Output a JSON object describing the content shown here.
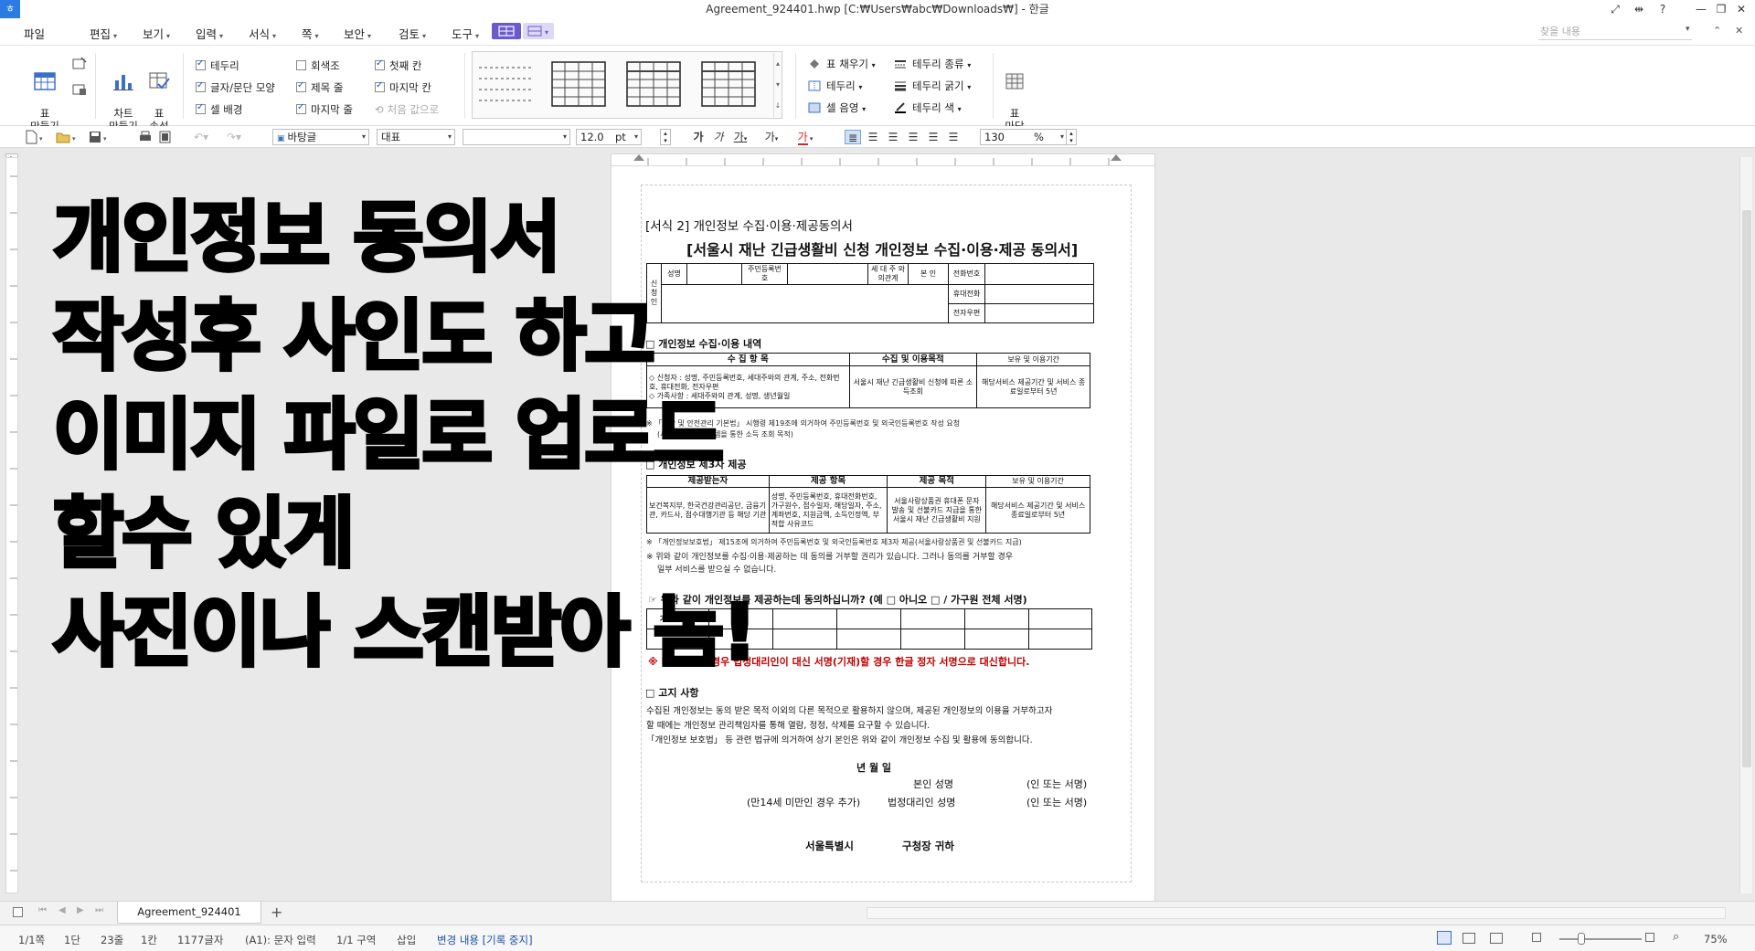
{
  "window": {
    "title": "Agreement_924401.hwp [C:₩Users₩abc₩Downloads₩] - 한글",
    "app_icon": "ㅎ",
    "controls": [
      "⤢",
      "⇹",
      "?",
      "—",
      "❐",
      "✕"
    ]
  },
  "menu": {
    "items": [
      "파일",
      "편집",
      "보기",
      "입력",
      "서식",
      "쪽",
      "보안",
      "검토",
      "도구"
    ],
    "search_placeholder": "찾을 내용",
    "right_controls": [
      "▾",
      "⌃",
      "✕"
    ]
  },
  "ribbon": {
    "table_make": "표\n만들기",
    "chart_make": "차트\n만들기",
    "table_props": "표\n속성",
    "checks_col1": [
      {
        "label": "테두리",
        "checked": true
      },
      {
        "label": "글자/문단 모양",
        "checked": true
      },
      {
        "label": "셀 배경",
        "checked": true
      }
    ],
    "checks_col2": [
      {
        "label": "회색조",
        "checked": false
      },
      {
        "label": "제목 줄",
        "checked": true
      },
      {
        "label": "마지막 줄",
        "checked": true
      }
    ],
    "checks_col3": [
      {
        "label": "첫째 칸",
        "checked": true
      },
      {
        "label": "마지막 칸",
        "checked": true
      },
      {
        "label": "처음 값으로",
        "checked": false,
        "disabled": true
      }
    ],
    "fill": [
      "표 채우기",
      "테두리",
      "셀 음영"
    ],
    "border": [
      "테두리 종류",
      "테두리 굵기",
      "테두리 색"
    ],
    "madang": "표\n마당"
  },
  "format": {
    "style": "바탕글",
    "font_rep": "대표",
    "font": "",
    "size": "12.0",
    "unit": "pt",
    "zoom": "130",
    "zoom_unit": "%",
    "char_buttons": [
      "가",
      "가",
      "가",
      "가",
      "가"
    ]
  },
  "overlay": {
    "lines": [
      "개인정보 동의서",
      "작성후 사인도 하고",
      "이미지 파일로 업로드",
      "할수 있게",
      "사진이나 스캔받아 놈!"
    ]
  },
  "document": {
    "form_label": "[서식 2] 개인정보 수집·이용·제공동의서",
    "main_title": "[서울시 재난 긴급생활비 신청 개인정보 수집·이용·제공 동의서]",
    "applicant_table": {
      "row1": [
        "성명",
        "",
        "주민등록번 호",
        "",
        "세 대 주 와의관계",
        "본 인",
        "전화번호",
        ""
      ],
      "row2": [
        "휴대전화",
        ""
      ],
      "row3": [
        "전자우편",
        ""
      ],
      "side": "신청인"
    },
    "section1_title": "□ 개인정보 수집·이용 내역",
    "collect_table": {
      "headers": [
        "수 집 항 목",
        "수집 및 이용목적",
        "보유 및 이용기간"
      ],
      "items": "◇ 신청자 : 성명, 주민등록번호, 세대주와의 관계, 주소, 전화번호, 휴대전화, 전자우편\n◇ 가족사항 : 세대주와의 관계, 성명, 생년월일",
      "purpose": "서울시 재난 긴급생활비 신청에 따른 소득조회",
      "period": "해당서비스 제공기간 및 서비스 종료일로부터 5년"
    },
    "note1": "※ 「재난 및 안전관리 기본법」 시행령 제19조에 의거하여 주민등록번호 및 외국인등록번호 작성 요청",
    "note1b": "(사회보장정보시스템을 통한 소득 조회 목적)",
    "section2_title": "□ 개인정보 제3자 제공",
    "provide_table": {
      "headers": [
        "제공받는자",
        "제공 항목",
        "제공 목적",
        "보유 및 이용기간"
      ],
      "receiver": "보건복지부, 한국건강관리공단, 금융기관, 카드사, 점수대행기관 등 해당 기관",
      "items": "성명, 주민등록번호, 휴대전화번호, 가구원수, 접수일자, 해당일자, 주소, 계좌번호, 지원금액, 소득인정액, 부적합 사유코드",
      "purpose": "서울사랑상품권 휴대폰 문자 발송 및 선불카드 지급을 통한 서울시 재난 긴급생활비 지원",
      "period": "해당서비스 제공기간 및 서비스 종료일로부터 5년"
    },
    "note2": "※ 「개인정보보호법」 제15조에 의거하여 주민등록번호 및 외국인등록번호 제3자 제공(서울사랑상품권 및 선불카드 지급)",
    "note3": "※ 위와 같이 개인정보를 수집·이용·제공하는 데 동의를 거부할 권리가 있습니다. 그러나 동의를 거부할 경우",
    "note3b": "일부 서비스를 받으실 수 없습니다.",
    "consent_q": "☞ 위와 같이 개인정보를 제공하는데 동의하십니까? (예 □ 아니오 □ / 가구원 전체 서명)",
    "family_label": "가구원 성명",
    "red_note": "※ 미성년자의 경우 법정대리인이 대신 서명(기재)할 경우 한글 정자 서명으로 대신합니다.",
    "section3_title": "□ 고지 사항",
    "notice1": "수집된 개인정보는 동의 받은 목적 이외의 다른 목적으로 활용하지 않으며, 제공된 개인정보의 이용을 거부하고자",
    "notice2": "할 때에는 개인정보 관리책임자를 통해 열람, 정정, 삭제를 요구할 수 있습니다.",
    "notice3": "「개인정보 보호법」 등 관련 법규에 의거하여 상기 본인은 위와 같이 개인정보 수집 및 활용에 동의합니다.",
    "date": "년   월   일",
    "sign1_label": "본인 성명",
    "sign1_tail": "(인 또는 서명)",
    "sign2_prefix": "(만14세 미만인 경우 추가)",
    "sign2_label": "법정대리인 성명",
    "sign2_tail": "(인 또는 서명)",
    "addressee_a": "서울특별시",
    "addressee_b": "구청장 귀하"
  },
  "tabs": {
    "doc_tab": "Agreement_924401",
    "add": "+"
  },
  "status": {
    "page": "1/1쪽",
    "section": "1단",
    "line": "23줄",
    "col": "1칸",
    "chars": "1177글자",
    "mode": "(A1): 문자 입력",
    "area": "1/1 구역",
    "insert": "삽입",
    "track": "변경 내용 [기록 중지]",
    "zoom": "75%"
  },
  "colors": {
    "accent": "#2c7be5",
    "workspace": "#e9e9e9",
    "red_text": "#c00000"
  }
}
